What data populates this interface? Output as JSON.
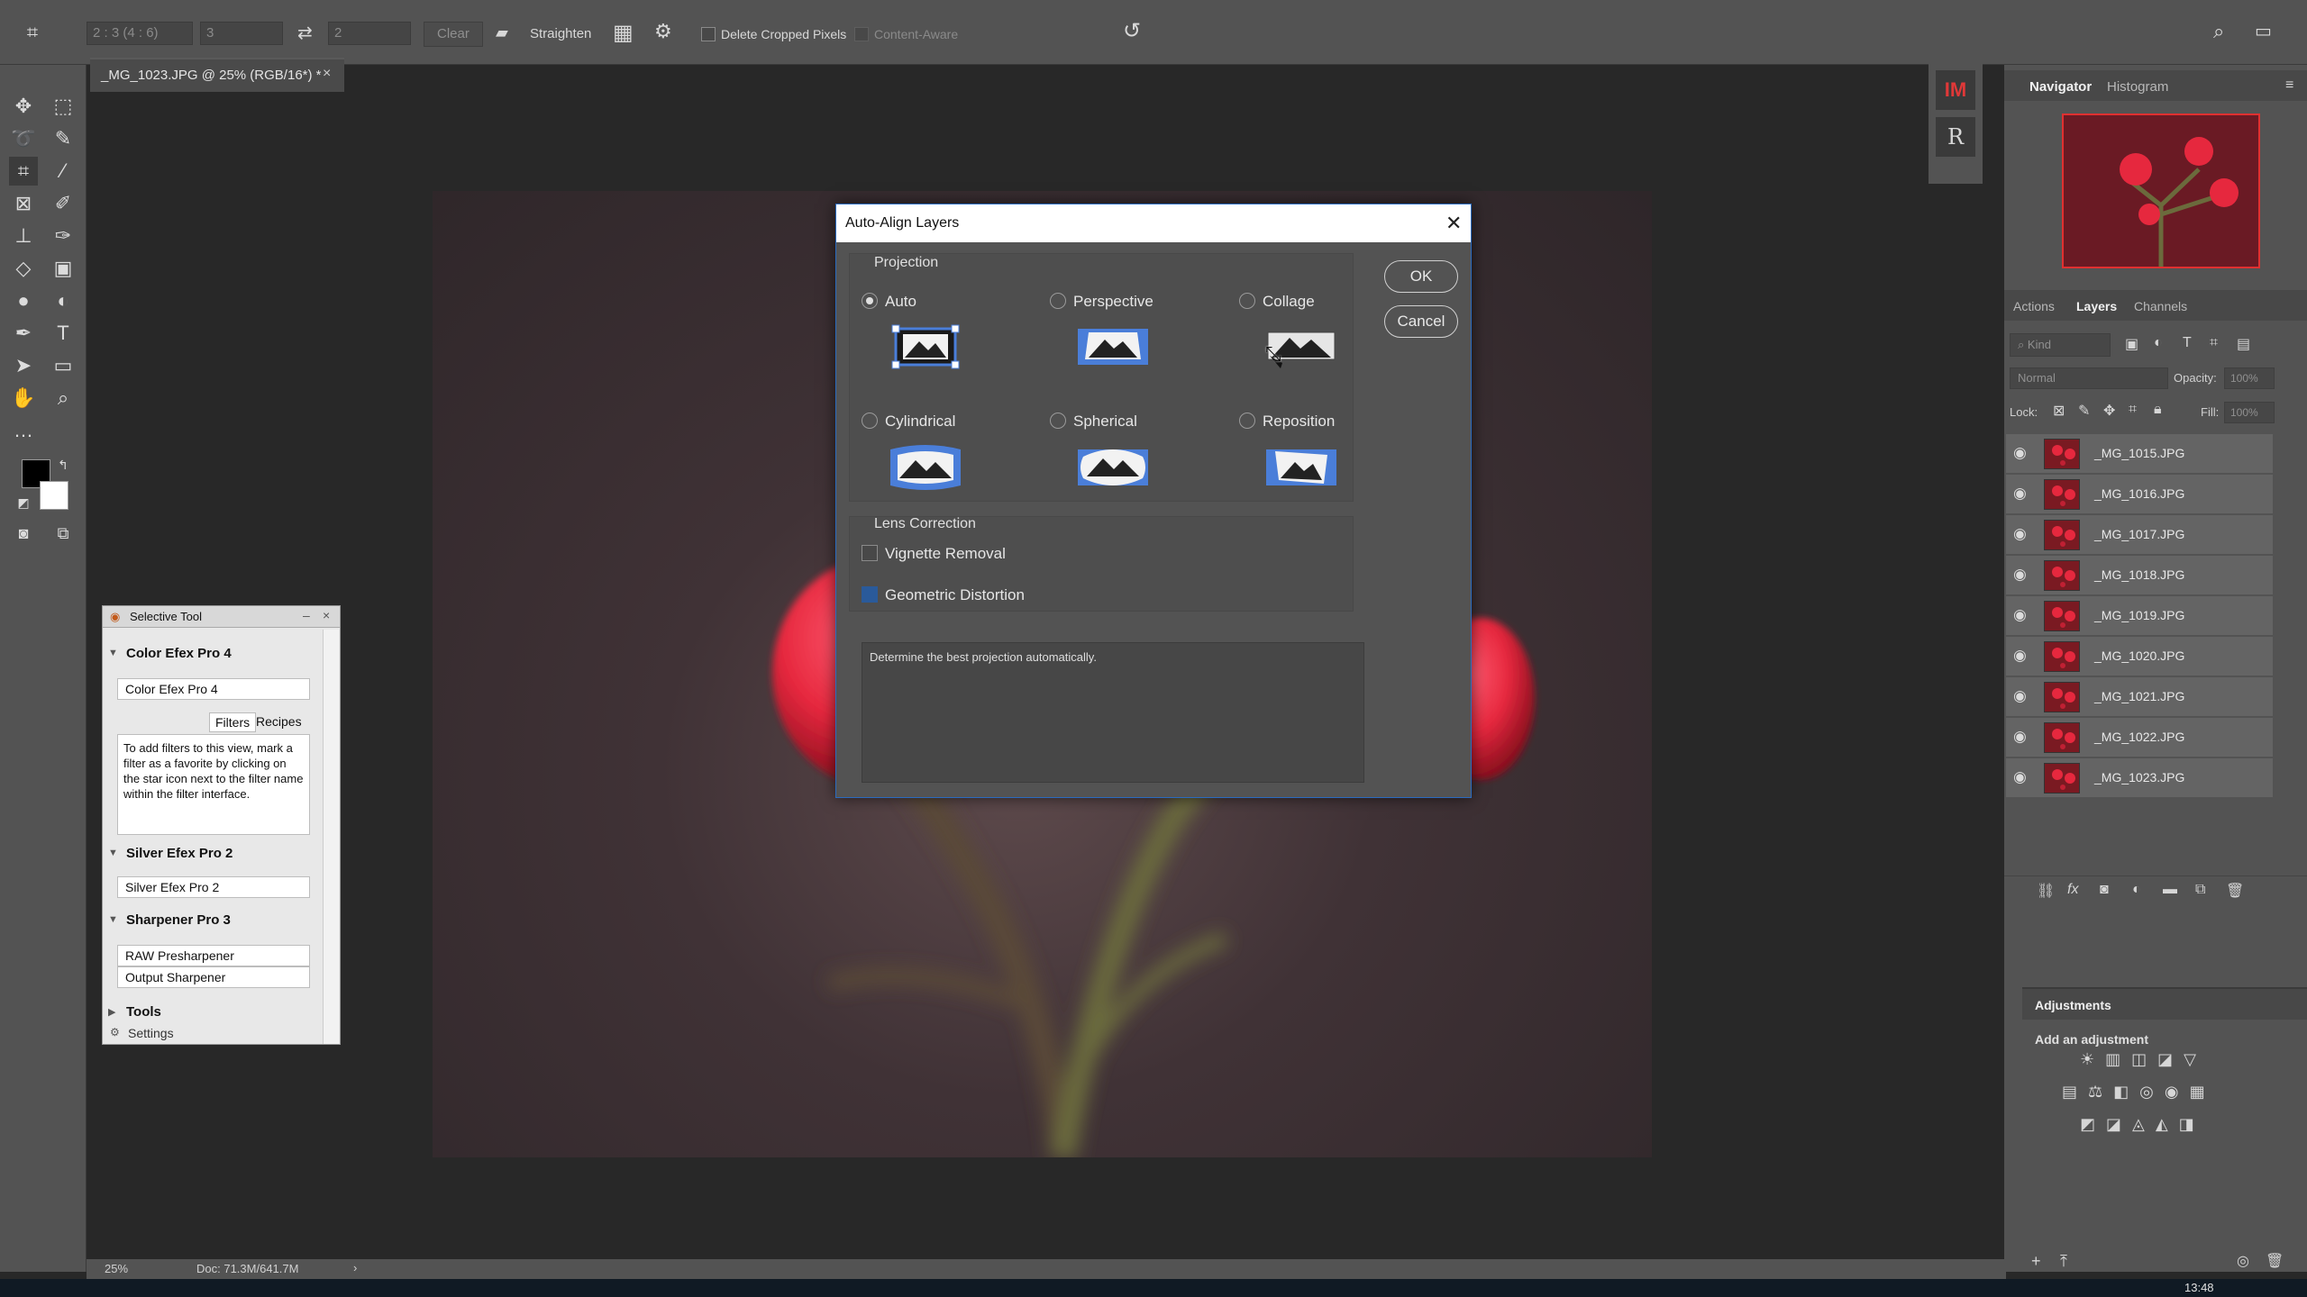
{
  "options_bar": {
    "ratio_value": "2 : 3 (4 : 6)",
    "width_value": "3",
    "height_value": "2",
    "clear_label": "Clear",
    "straighten_label": "Straighten",
    "delete_cropped_label": "Delete Cropped Pixels",
    "content_aware_label": "Content-Aware"
  },
  "document": {
    "tab_title": "_MG_1023.JPG @ 25% (RGB/16*) *",
    "zoom": "25%",
    "doc_size": "Doc: 71.3M/641.7M"
  },
  "dialog": {
    "title": "Auto-Align Layers",
    "projection_label": "Projection",
    "options": [
      {
        "label": "Auto",
        "selected": true
      },
      {
        "label": "Perspective",
        "selected": false
      },
      {
        "label": "Collage",
        "selected": false
      },
      {
        "label": "Cylindrical",
        "selected": false
      },
      {
        "label": "Spherical",
        "selected": false
      },
      {
        "label": "Reposition",
        "selected": false
      }
    ],
    "lens_correction_label": "Lens Correction",
    "vignette_label": "Vignette Removal",
    "geometric_label": "Geometric Distortion",
    "description": "Determine the best projection automatically.",
    "ok_label": "OK",
    "cancel_label": "Cancel"
  },
  "selective_tool": {
    "title": "Selective Tool",
    "color_efex_header": "Color Efex Pro 4",
    "color_efex_field": "Color Efex Pro 4",
    "filters_tab": "Filters",
    "recipes_tab": "Recipes",
    "info_text": "To add filters to this view, mark a filter as a favorite by clicking on the star icon next to the filter name within the filter interface.",
    "silver_header": "Silver Efex Pro 2",
    "silver_field": "Silver Efex Pro 2",
    "sharpener_header": "Sharpener Pro 3",
    "raw_presharpener": "RAW Presharpener",
    "output_sharpener": "Output Sharpener",
    "tools_label": "Tools",
    "settings_label": "Settings"
  },
  "right_strip": {
    "im_label": "IM",
    "r_label": "R"
  },
  "navigator": {
    "tab_navigator": "Navigator",
    "tab_histogram": "Histogram"
  },
  "layers_panel": {
    "tab_actions": "Actions",
    "tab_layers": "Layers",
    "tab_channels": "Channels",
    "kind_placeholder": "Kind",
    "blend_mode": "Normal",
    "opacity_label": "Opacity:",
    "opacity_value": "100%",
    "lock_label": "Lock:",
    "fill_label": "Fill:",
    "fill_value": "100%",
    "layers": [
      "_MG_1015.JPG",
      "_MG_1016.JPG",
      "_MG_1017.JPG",
      "_MG_1018.JPG",
      "_MG_1019.JPG",
      "_MG_1020.JPG",
      "_MG_1021.JPG",
      "_MG_1022.JPG",
      "_MG_1023.JPG"
    ]
  },
  "adjustments": {
    "title": "Adjustments",
    "subtitle": "Add an adjustment"
  },
  "taskbar": {
    "time": "13:48"
  },
  "colors": {
    "accent": "#2a6bbf",
    "panel": "#535353",
    "canvas": "#282828",
    "berry": "#e6283e"
  }
}
